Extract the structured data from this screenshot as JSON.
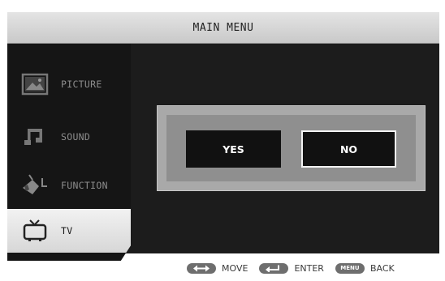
{
  "header": {
    "title": "MAIN MENU"
  },
  "sidebar": {
    "items": [
      {
        "label": "PICTURE",
        "icon": "picture-icon",
        "active": false
      },
      {
        "label": "SOUND",
        "icon": "music-note-icon",
        "active": false
      },
      {
        "label": "FUNCTION",
        "icon": "function-icon",
        "active": false
      },
      {
        "label": "TV",
        "icon": "tv-icon",
        "active": true
      }
    ]
  },
  "dialog": {
    "yes_label": "YES",
    "no_label": "NO",
    "selected": "NO"
  },
  "footer": {
    "hints": [
      {
        "key_icon": "left-right-arrow-icon",
        "label": "MOVE"
      },
      {
        "key_icon": "enter-arrow-icon",
        "label": "ENTER"
      },
      {
        "key_label": "MENU",
        "label": "BACK"
      }
    ]
  },
  "colors": {
    "background": "#1c1c1c",
    "active_item": "#e6e6e6",
    "dialog": "#a9a9a9",
    "button": "#111111"
  }
}
